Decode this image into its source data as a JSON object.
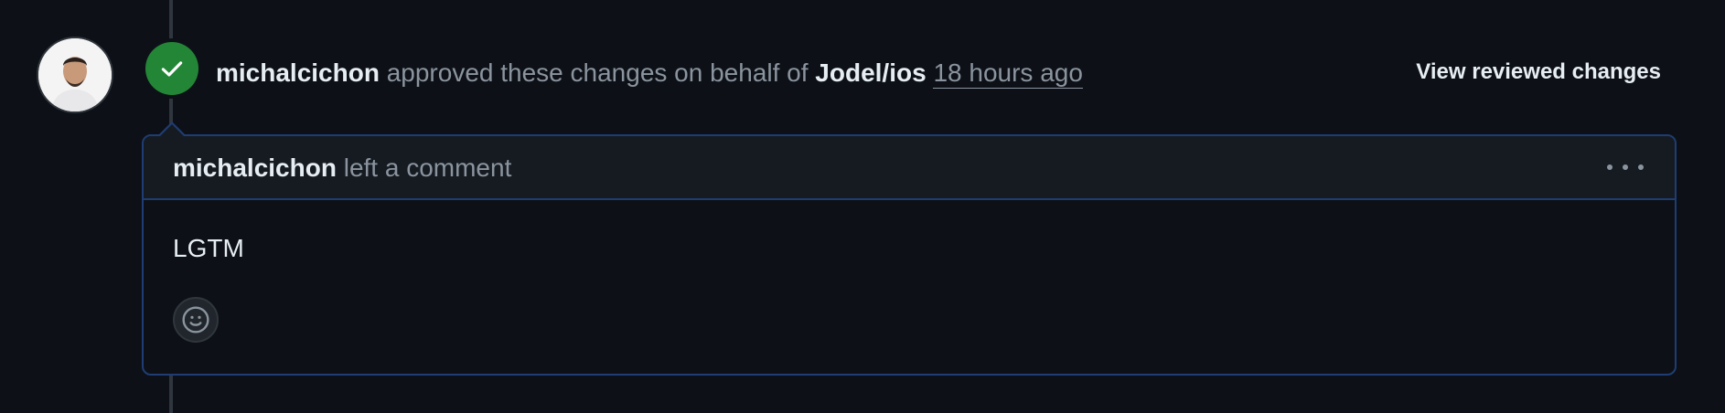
{
  "review": {
    "author": "michalcichon",
    "action_text": "approved these changes on behalf of",
    "organization": "Jodel/ios",
    "time_ago": "18 hours ago",
    "view_changes_label": "View reviewed changes"
  },
  "comment": {
    "author": "michalcichon",
    "action_text": "left a comment",
    "body": "LGTM"
  },
  "icons": {
    "badge": "check-icon",
    "menu": "kebab-horizontal-icon",
    "reaction": "smiley-icon"
  },
  "colors": {
    "background": "#0d1117",
    "approved": "#238636",
    "border_accent": "#1f3d73",
    "muted_text": "#8b949e",
    "primary_text": "#e6edf3"
  }
}
